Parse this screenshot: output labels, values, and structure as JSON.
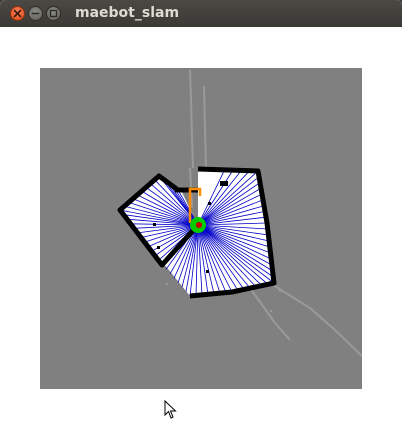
{
  "window": {
    "title": "maebot_slam"
  },
  "map": {
    "background_color": "#808080",
    "free_color": "#ffffff",
    "wall_color": "#000000",
    "ray_color": "#0000c8",
    "robot_color": "#00cc00",
    "pose_color": "#cc0000",
    "path_color": "#ff8c00"
  },
  "icons": {
    "close": "close-icon",
    "minimize": "minimize-icon",
    "maximize": "maximize-icon",
    "cursor": "mouse-cursor-icon"
  }
}
